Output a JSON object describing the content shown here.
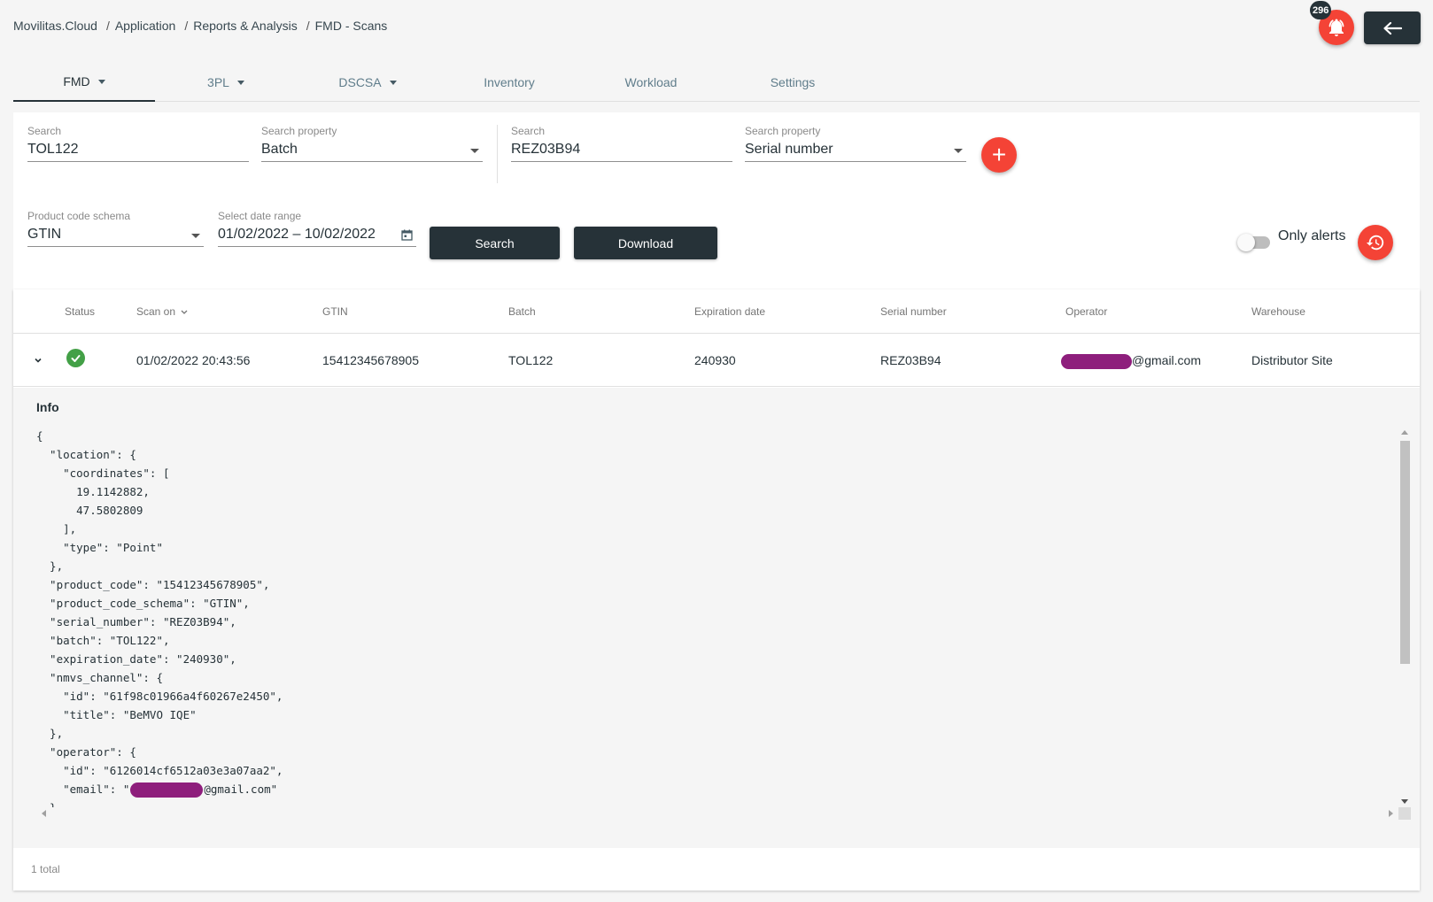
{
  "breadcrumb": {
    "items": [
      "Movilitas.Cloud",
      "Application",
      "Reports & Analysis",
      "FMD - Scans"
    ],
    "separator": "/"
  },
  "header": {
    "notifications_count": "296",
    "bell_icon": "bell-alert-icon",
    "back_icon": "arrow-left-icon"
  },
  "tabs": [
    {
      "label": "FMD",
      "dropdown": true,
      "active": true
    },
    {
      "label": "3PL",
      "dropdown": true
    },
    {
      "label": "DSCSA",
      "dropdown": true
    },
    {
      "label": "Inventory"
    },
    {
      "label": "Workload"
    },
    {
      "label": "Settings"
    }
  ],
  "filters": {
    "search1": {
      "label": "Search",
      "value": "TOL122"
    },
    "property1": {
      "label": "Search property",
      "value": "Batch"
    },
    "search2": {
      "label": "Search",
      "value": "REZ03B94"
    },
    "property2": {
      "label": "Search property",
      "value": "Serial number"
    },
    "schema": {
      "label": "Product code schema",
      "value": "GTIN"
    },
    "date_range": {
      "label": "Select date range",
      "value": "01/02/2022 – 10/02/2022"
    },
    "add_label": "+",
    "search_button": "Search",
    "download_button": "Download",
    "only_alerts_label": "Only alerts",
    "only_alerts_on": false
  },
  "table": {
    "columns": [
      "Status",
      "Scan on",
      "GTIN",
      "Batch",
      "Expiration date",
      "Serial number",
      "Operator",
      "Warehouse"
    ],
    "rows": [
      {
        "status": "ok",
        "scan_on": "01/02/2022 20:43:56",
        "gtin": "15412345678905",
        "batch": "TOL122",
        "expiration_date": "240930",
        "serial_number": "REZ03B94",
        "operator_suffix": "@gmail.com",
        "warehouse": "Distributor Site"
      }
    ],
    "total": "1 total"
  },
  "detail": {
    "title": "Info",
    "json_lines": [
      "{",
      "  \"location\": {",
      "    \"coordinates\": [",
      "      19.1142882,",
      "      47.5802809",
      "    ],",
      "    \"type\": \"Point\"",
      "  },",
      "  \"product_code\": \"15412345678905\",",
      "  \"product_code_schema\": \"GTIN\",",
      "  \"serial_number\": \"REZ03B94\",",
      "  \"batch\": \"TOL122\",",
      "  \"expiration_date\": \"240930\",",
      "  \"nmvs_channel\": {",
      "    \"id\": \"61f98c01966a4f60267e2450\",",
      "    \"title\": \"BeMVO IQE\"",
      "  },",
      "  \"operator\": {",
      "    \"id\": \"6126014cf6512a03e3a07aa2\",",
      "    \"email_prefix\": \"    \\\"email\\\": \\\"\",",
      "    \"email_suffix\": \"@gmail.com\\\"\"",
      "  }"
    ]
  },
  "colors": {
    "accent": "#f44336",
    "dark": "#263238",
    "success": "#43a047",
    "redaction": "#8e1e7c"
  }
}
